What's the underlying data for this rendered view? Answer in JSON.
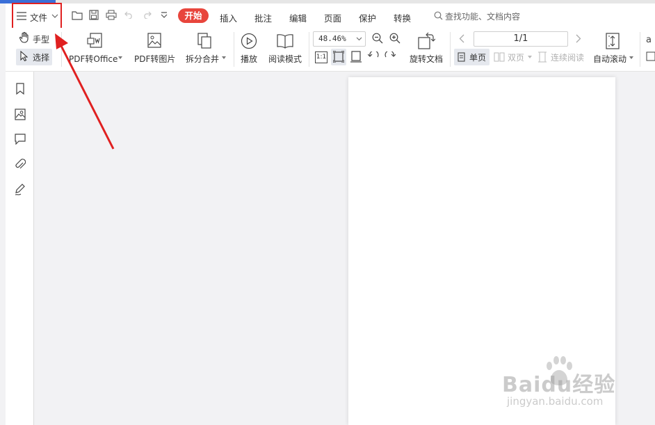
{
  "menu": {
    "file_label": "文件",
    "tabs": [
      "开始",
      "插入",
      "批注",
      "编辑",
      "页面",
      "保护",
      "转换"
    ],
    "search_placeholder": "查找功能、文档内容"
  },
  "ribbon": {
    "hand_label": "手型",
    "select_label": "选择",
    "pdf_to_office": "PDF转Office",
    "pdf_to_image": "PDF转图片",
    "split_merge": "拆分合并",
    "play": "播放",
    "read_mode": "阅读模式",
    "zoom_value": "48.46%",
    "actual_size": "1:1",
    "rotate_doc": "旋转文档",
    "page_indicator": "1/1",
    "single_page": "单页",
    "double_page": "双页",
    "continuous_read": "连续阅读",
    "auto_scroll": "自动滚动"
  },
  "watermark": {
    "brand": "Baidu经验",
    "url": "jingyan.baidu.com"
  },
  "colors": {
    "accent_red": "#e8453c",
    "highlight_box": "#e02020",
    "arrow": "#e02020"
  }
}
